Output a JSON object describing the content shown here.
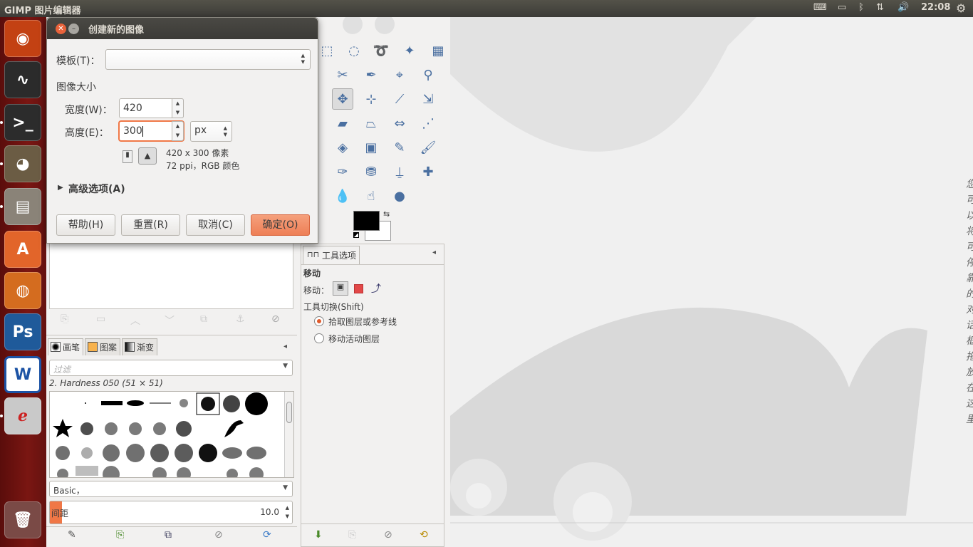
{
  "topbar": {
    "title": "GIMP 图片编辑器",
    "indicators": {
      "keyboard": "⌨",
      "battery": "▭",
      "bluetooth": "ᛒ",
      "network": "⇅",
      "volume": "🔊",
      "time": "22:08",
      "settings": "⚙"
    }
  },
  "launcher": {
    "items": [
      {
        "name": "ubuntu-dash",
        "glyph": "◉",
        "color": "#c34113"
      },
      {
        "name": "system-monitor",
        "glyph": "∿",
        "color": "#2b2b2b"
      },
      {
        "name": "terminal",
        "glyph": ">_",
        "color": "#2c2c2c"
      },
      {
        "name": "gimp",
        "glyph": "◕",
        "color": "#6b5c44"
      },
      {
        "name": "files",
        "glyph": "▤",
        "color": "#8a8378"
      },
      {
        "name": "software-center",
        "glyph": "A",
        "color": "#e2652a"
      },
      {
        "name": "firefox",
        "glyph": "◍",
        "color": "#d46c1f"
      },
      {
        "name": "photoshop",
        "glyph": "Ps",
        "color": "#1f5a9a"
      },
      {
        "name": "wps-writer",
        "glyph": "W",
        "color": "#1c53a5"
      },
      {
        "name": "document-viewer",
        "glyph": "ℯ",
        "color": "#c9c9c9"
      },
      {
        "name": "trash",
        "glyph": "🗑",
        "color": "#7a4a46"
      }
    ]
  },
  "dialog": {
    "title": "创建新的图像",
    "template_label": "模板(T)：",
    "template_value": "",
    "size_heading": "图像大小",
    "width_label": "宽度(W)：",
    "width_value": "420",
    "height_label": "高度(E)：",
    "height_value": "300",
    "unit": "px",
    "info_line1": "420 x 300 像素",
    "info_line2": "72 ppi，RGB 颜色",
    "advanced": "高级选项(A)",
    "buttons": {
      "help": "帮助(H)",
      "reset": "重置(R)",
      "cancel": "取消(C)",
      "ok": "确定(O)"
    }
  },
  "tool_options": {
    "tab": "工具选项",
    "tool_name": "移动",
    "move_label": "移动：",
    "switch_label": "工具切换(Shift)",
    "option1": "拾取图层或参考线",
    "option2": "移动活动图层"
  },
  "brushes": {
    "tabs": [
      "画笔",
      "图案",
      "渐变"
    ],
    "filter_placeholder": "过滤",
    "current": "2. Hardness 050 (51 × 51)",
    "tag_value": "Basic，",
    "spacing_label": "间距",
    "spacing_value": "10.0",
    "spacing_fraction": 0.1
  },
  "canvas_hint": "您可以将可停靠的对话框拖放在这里",
  "colors": {
    "accent": "#f07746",
    "launcher": "#7a1612",
    "fg": "#000000",
    "bg": "#ffffff"
  }
}
